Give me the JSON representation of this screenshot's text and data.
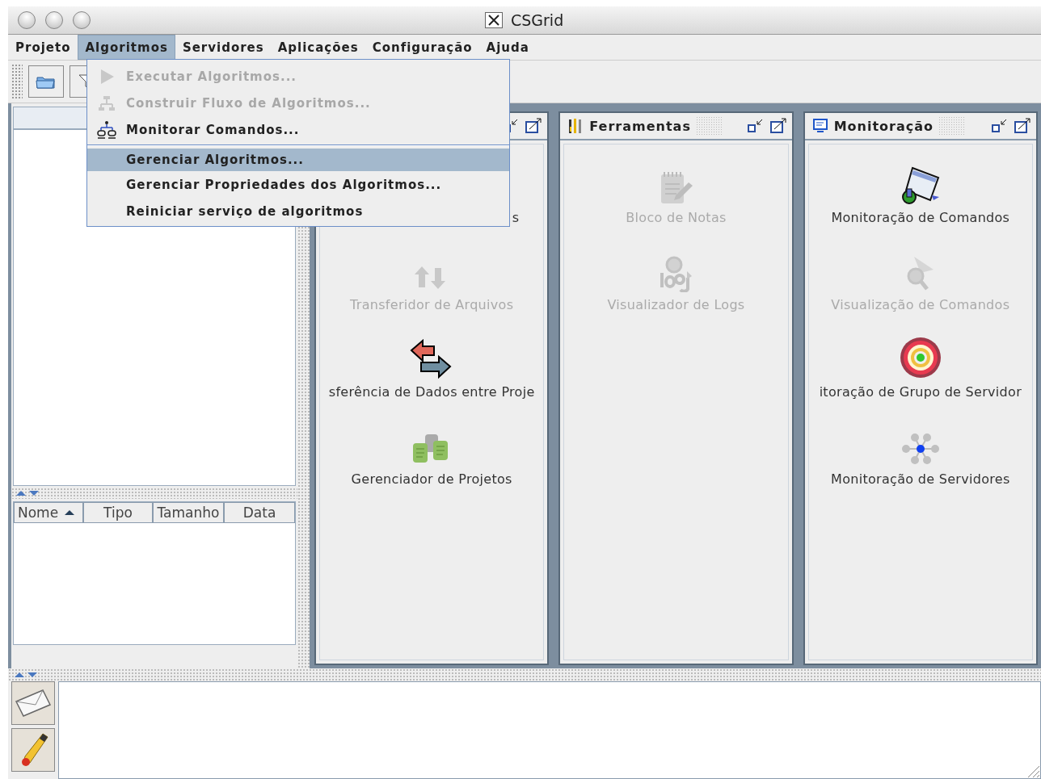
{
  "window": {
    "title": "CSGrid"
  },
  "menu_bar": [
    {
      "label": "Projeto",
      "selected": false
    },
    {
      "label": "Algoritmos",
      "selected": true
    },
    {
      "label": "Servidores",
      "selected": false
    },
    {
      "label": "Aplicações",
      "selected": false
    },
    {
      "label": "Configuração",
      "selected": false
    },
    {
      "label": "Ajuda",
      "selected": false
    }
  ],
  "open_menu": {
    "groups": [
      [
        {
          "label": "Executar Algoritmos...",
          "kind": "play",
          "disabled": true,
          "selected": false
        },
        {
          "label": "Construir Fluxo de Algoritmos...",
          "kind": "flow",
          "disabled": true,
          "selected": false
        },
        {
          "label": "Monitorar Comandos...",
          "kind": "monitor",
          "disabled": false,
          "selected": false
        }
      ],
      [
        {
          "label": "Gerenciar Algoritmos...",
          "kind": "plain",
          "disabled": false,
          "selected": true
        },
        {
          "label": "Gerenciar Propriedades dos Algoritmos...",
          "kind": "plain",
          "disabled": false,
          "selected": false
        },
        {
          "label": "Reiniciar serviço de algoritmos",
          "kind": "plain",
          "disabled": false,
          "selected": false
        }
      ]
    ]
  },
  "file_table": {
    "columns": [
      {
        "label": "Nome",
        "sorted": true
      },
      {
        "label": "Tipo",
        "sorted": false
      },
      {
        "label": "Tamanho",
        "sorted": false
      },
      {
        "label": "Data",
        "sorted": false
      }
    ]
  },
  "panels": [
    {
      "items": [
        {
          "label": "s",
          "kind": "covered",
          "disabled": false
        },
        {
          "label": "Transferidor de Arquivos",
          "kind": "transfer",
          "disabled": true
        },
        {
          "label": "sferência de Dados entre Proje",
          "kind": "swap",
          "disabled": false
        },
        {
          "label": "Gerenciador de Projetos",
          "kind": "projects",
          "disabled": false
        }
      ]
    },
    {
      "title": "Ferramentas",
      "items": [
        {
          "label": "Bloco de Notas",
          "kind": "notepad",
          "disabled": true
        },
        {
          "label": "Visualizador de Logs",
          "kind": "log",
          "disabled": true
        }
      ]
    },
    {
      "title": "Monitoração",
      "items": [
        {
          "label": "Monitoração de Comandos",
          "kind": "cmdmon",
          "disabled": false
        },
        {
          "label": "Visualização de Comandos",
          "kind": "cmdview",
          "disabled": true
        },
        {
          "label": "itoração de Grupo de Servidor",
          "kind": "target",
          "disabled": false
        },
        {
          "label": "Monitoração de Servidores",
          "kind": "network",
          "disabled": false
        }
      ]
    }
  ]
}
